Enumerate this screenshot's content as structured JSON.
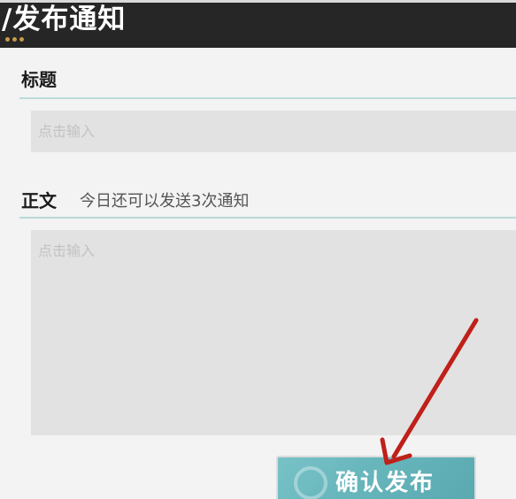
{
  "header": {
    "title": "/发布通知"
  },
  "title_section": {
    "label": "标题",
    "input_placeholder": "点击输入"
  },
  "body_section": {
    "label": "正文",
    "hint": "今日还可以发送3次通知",
    "textarea_placeholder": "点击输入"
  },
  "actions": {
    "confirm_label": "确认发布"
  },
  "annotation": {
    "arrow_color": "#c0201a"
  }
}
